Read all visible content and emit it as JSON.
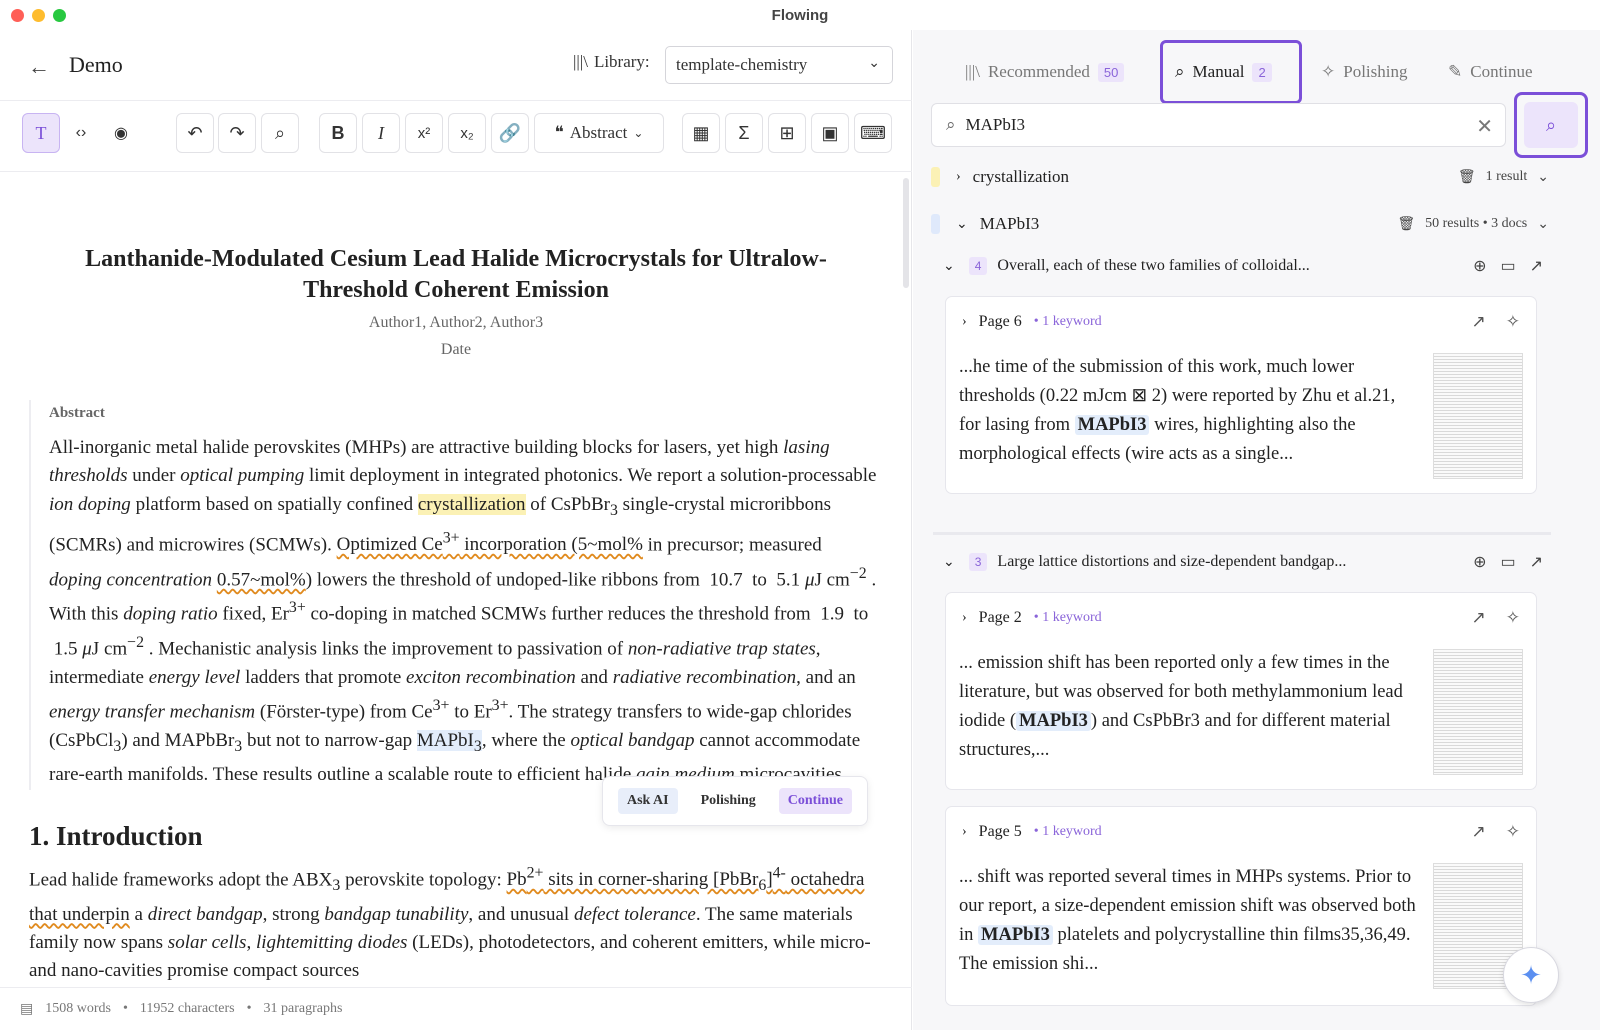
{
  "window": {
    "title": "Flowing"
  },
  "editor": {
    "doc_title": "Demo",
    "library_label": "Library:",
    "library_value": "template-chemistry",
    "toolbar": {
      "heading_select": "Abstract"
    },
    "paper": {
      "title": "Lanthanide-Modulated Cesium Lead Halide Microcrystals for Ultralow-Threshold Coherent Emission",
      "authors": "Author1, Author2, Author3",
      "date": "Date",
      "abstract_label": "Abstract",
      "intro_heading": "1. Introduction"
    },
    "popup": {
      "ask_ai": "Ask AI",
      "polishing": "Polishing",
      "continue": "Continue"
    },
    "status": {
      "words": "1508 words",
      "characters": "11952 characters",
      "paragraphs": "31 paragraphs"
    }
  },
  "panel": {
    "tabs": [
      {
        "label": "Recommended",
        "badge": "50"
      },
      {
        "label": "Manual",
        "badge": "2"
      },
      {
        "label": "Polishing"
      },
      {
        "label": "Continue"
      }
    ],
    "search_value": "MAPbI3",
    "keywords": [
      {
        "label": "crystallization",
        "meta": "1 result",
        "color": "#fbf1b5"
      },
      {
        "label": "MAPbI3",
        "meta": "50 results • 3 docs",
        "color": "#dfe9fb"
      }
    ],
    "docs": [
      {
        "num": "4",
        "title": "Overall, each of these two families of colloidal...",
        "pages": [
          {
            "page": "Page 6",
            "kw": "1 keyword"
          }
        ]
      },
      {
        "num": "3",
        "title": "Large lattice distortions and size-dependent bandgap...",
        "pages": [
          {
            "page": "Page 2",
            "kw": "1 keyword"
          },
          {
            "page": "Page 5",
            "kw": "1 keyword"
          }
        ]
      }
    ]
  },
  "accent": "#7b4fd8"
}
